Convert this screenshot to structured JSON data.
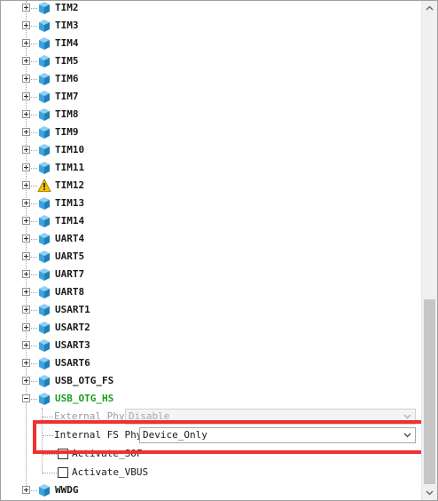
{
  "tree": {
    "items": [
      {
        "label": "TIM2",
        "icon": "peripheral-cube-icon"
      },
      {
        "label": "TIM3",
        "icon": "peripheral-cube-icon"
      },
      {
        "label": "TIM4",
        "icon": "peripheral-cube-icon"
      },
      {
        "label": "TIM5",
        "icon": "peripheral-cube-icon"
      },
      {
        "label": "TIM6",
        "icon": "peripheral-cube-icon"
      },
      {
        "label": "TIM7",
        "icon": "peripheral-cube-icon"
      },
      {
        "label": "TIM8",
        "icon": "peripheral-cube-icon"
      },
      {
        "label": "TIM9",
        "icon": "peripheral-cube-icon"
      },
      {
        "label": "TIM10",
        "icon": "peripheral-cube-icon"
      },
      {
        "label": "TIM11",
        "icon": "peripheral-cube-icon"
      },
      {
        "label": "TIM12",
        "icon": "warning-triangle-icon"
      },
      {
        "label": "TIM13",
        "icon": "peripheral-cube-icon"
      },
      {
        "label": "TIM14",
        "icon": "peripheral-cube-icon"
      },
      {
        "label": "UART4",
        "icon": "peripheral-cube-icon"
      },
      {
        "label": "UART5",
        "icon": "peripheral-cube-icon"
      },
      {
        "label": "UART7",
        "icon": "peripheral-cube-icon"
      },
      {
        "label": "UART8",
        "icon": "peripheral-cube-icon"
      },
      {
        "label": "USART1",
        "icon": "peripheral-cube-icon"
      },
      {
        "label": "USART2",
        "icon": "peripheral-cube-icon"
      },
      {
        "label": "USART3",
        "icon": "peripheral-cube-icon"
      },
      {
        "label": "USART6",
        "icon": "peripheral-cube-icon"
      },
      {
        "label": "USB_OTG_FS",
        "icon": "peripheral-cube-icon"
      },
      {
        "label": "USB_OTG_HS",
        "icon": "peripheral-cube-icon",
        "expanded": true,
        "color": "#1aa01a"
      }
    ],
    "usb_otg_hs": {
      "external_phy": {
        "label": "External Phy",
        "value": "Disable"
      },
      "internal_fs_phy": {
        "label": "Internal FS Phy",
        "value": "Device_Only"
      },
      "activate_sof": {
        "label": "Activate_SOF",
        "checked": false
      },
      "activate_vbus": {
        "label": "Activate_VBUS",
        "checked": false
      }
    },
    "last_item": {
      "label": "WWDG",
      "icon": "peripheral-cube-icon"
    }
  },
  "colors": {
    "highlight": "#ef3131",
    "enabled_green": "#1aa01a",
    "cube_blue": "#3aa3dc"
  }
}
